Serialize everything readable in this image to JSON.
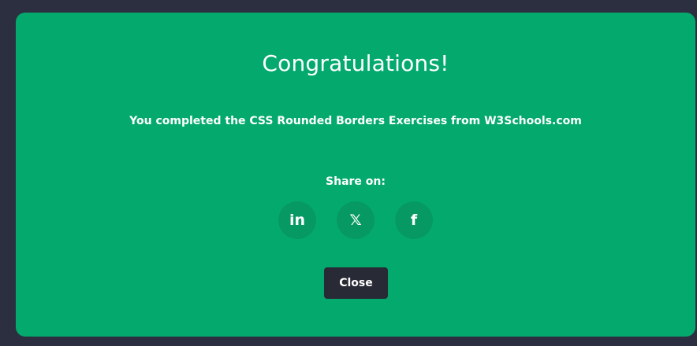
{
  "modal": {
    "title": "Congratulations!",
    "message": "You completed the CSS Rounded Borders Exercises from W3Schools.com",
    "share_label": "Share on:",
    "share_buttons": [
      {
        "icon": "linkedin-icon",
        "glyph": "in"
      },
      {
        "icon": "x-icon",
        "glyph": "𝕏"
      },
      {
        "icon": "facebook-icon",
        "glyph": "f"
      }
    ],
    "close_label": "Close"
  },
  "colors": {
    "modal_background": "#04aa6d",
    "share_button_background": "#079963",
    "close_button_background": "#282a35",
    "page_background": "#2b2f3f"
  }
}
